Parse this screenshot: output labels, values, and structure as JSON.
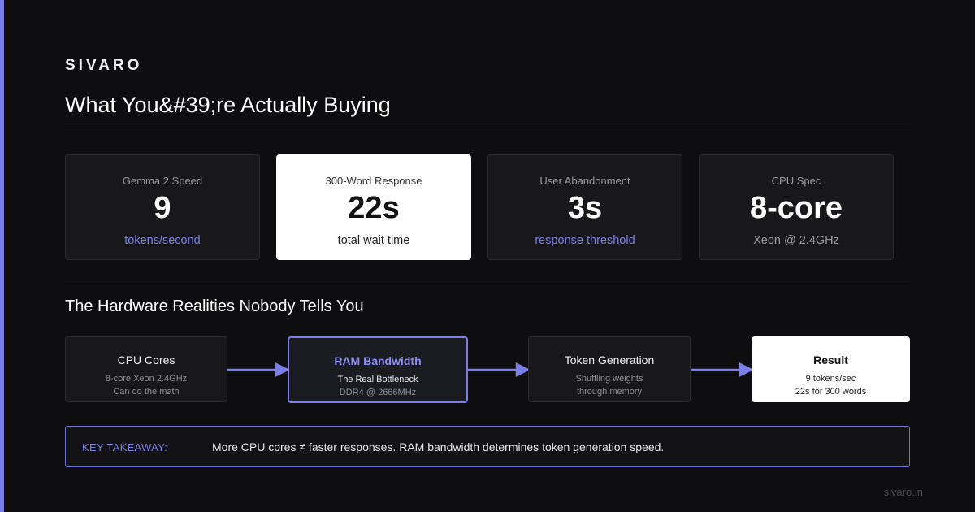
{
  "brand": "SIVARO",
  "title": "What You&#39;re Actually Buying",
  "stats": [
    {
      "label": "Gemma 2 Speed",
      "value": "9",
      "sub": "tokens/second"
    },
    {
      "label": "300-Word Response",
      "value": "22s",
      "sub": "total wait time"
    },
    {
      "label": "User Abandonment",
      "value": "3s",
      "sub": "response threshold"
    },
    {
      "label": "CPU Spec",
      "value": "8-core",
      "sub": "Xeon @ 2.4GHz"
    }
  ],
  "section_title": "The Hardware Realities Nobody Tells You",
  "flow": [
    {
      "title": "CPU Cores",
      "line1": "8-core Xeon 2.4GHz",
      "line2": "Can do the math"
    },
    {
      "title": "RAM Bandwidth",
      "line1": "The Real Bottleneck",
      "line2": "DDR4 @ 2666MHz"
    },
    {
      "title": "Token Generation",
      "line1": "Shuffling weights",
      "line2": "through memory"
    },
    {
      "title": "Result",
      "line1": "9 tokens/sec",
      "line2": "22s for 300 words"
    }
  ],
  "takeaway": {
    "label": "KEY TAKEAWAY:",
    "text": "More CPU cores ≠ faster responses. RAM bandwidth determines token generation speed."
  },
  "footer_url": "sivaro.in",
  "colors": {
    "accent": "#7b7fe6",
    "background": "#0e0e10",
    "card": "#18181b"
  }
}
